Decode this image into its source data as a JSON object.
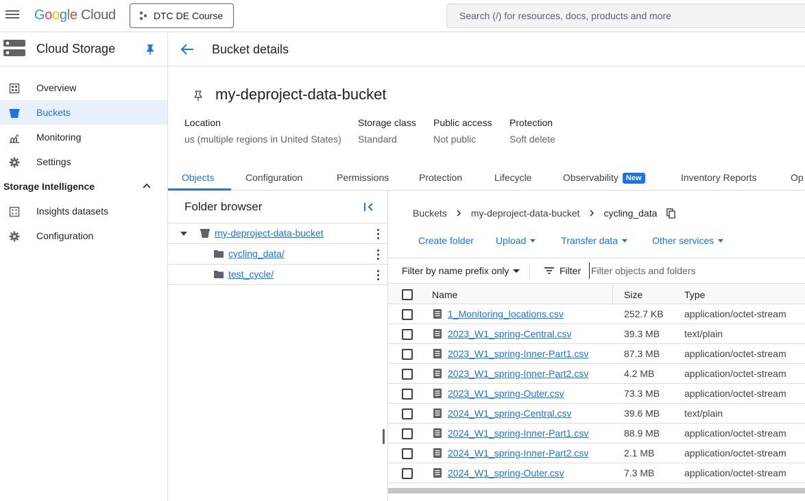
{
  "topbar": {
    "logo_google": [
      "G",
      "o",
      "o",
      "g",
      "l",
      "e"
    ],
    "logo_cloud": "Cloud",
    "project": "DTC DE Course",
    "search_placeholder": "Search (/) for resources, docs, products and more"
  },
  "sidebar": {
    "title": "Cloud Storage",
    "items": [
      {
        "label": "Overview",
        "icon": "overview-icon"
      },
      {
        "label": "Buckets",
        "icon": "bucket-icon",
        "active": true
      },
      {
        "label": "Monitoring",
        "icon": "monitoring-icon"
      },
      {
        "label": "Settings",
        "icon": "settings-icon"
      }
    ],
    "section": "Storage Intelligence",
    "section_items": [
      {
        "label": "Insights datasets",
        "icon": "dataset-icon"
      },
      {
        "label": "Configuration",
        "icon": "gear-icon"
      }
    ]
  },
  "page": {
    "title": "Bucket details",
    "bucket_name": "my-deproject-data-bucket",
    "meta": [
      {
        "key": "Location",
        "value": "us (multiple regions in United States)"
      },
      {
        "key": "Storage class",
        "value": "Standard"
      },
      {
        "key": "Public access",
        "value": "Not public"
      },
      {
        "key": "Protection",
        "value": "Soft delete"
      }
    ],
    "tabs": [
      "Objects",
      "Configuration",
      "Permissions",
      "Protection",
      "Lifecycle",
      "Observability",
      "Inventory Reports",
      "Op"
    ],
    "new_badge": "New"
  },
  "folder_browser": {
    "title": "Folder browser",
    "root": "my-deproject-data-bucket",
    "folders": [
      "cycling_data/",
      "test_cycle/"
    ]
  },
  "objects": {
    "breadcrumb": [
      "Buckets",
      "my-deproject-data-bucket",
      "cycling_data"
    ],
    "actions": {
      "create_folder": "Create folder",
      "upload": "Upload",
      "transfer": "Transfer data",
      "other": "Other services"
    },
    "filter_mode": "Filter by name prefix only",
    "filter_label": "Filter",
    "filter_placeholder": "Filter objects and folders",
    "columns": {
      "name": "Name",
      "size": "Size",
      "type": "Type"
    },
    "rows": [
      {
        "name": "1_Monitoring_locations.csv",
        "size": "252.7 KB",
        "type": "application/octet-stream"
      },
      {
        "name": "2023_W1_spring-Central.csv",
        "size": "39.3 MB",
        "type": "text/plain"
      },
      {
        "name": "2023_W1_spring-Inner-Part1.csv",
        "size": "87.3 MB",
        "type": "application/octet-stream"
      },
      {
        "name": "2023_W1_spring-Inner-Part2.csv",
        "size": "4.2 MB",
        "type": "application/octet-stream"
      },
      {
        "name": "2023_W1_spring-Outer.csv",
        "size": "73.3 MB",
        "type": "application/octet-stream"
      },
      {
        "name": "2024_W1_spring-Central.csv",
        "size": "39.6 MB",
        "type": "text/plain"
      },
      {
        "name": "2024_W1_spring-Inner-Part1.csv",
        "size": "88.9 MB",
        "type": "application/octet-stream"
      },
      {
        "name": "2024_W1_spring-Inner-Part2.csv",
        "size": "2.1 MB",
        "type": "application/octet-stream"
      },
      {
        "name": "2024_W1_spring-Outer.csv",
        "size": "7.3 MB",
        "type": "application/octet-stream"
      }
    ]
  },
  "colors": {
    "accent": "#1a73e8",
    "active_bg": "#e8f0fe",
    "border": "#dadce0"
  }
}
